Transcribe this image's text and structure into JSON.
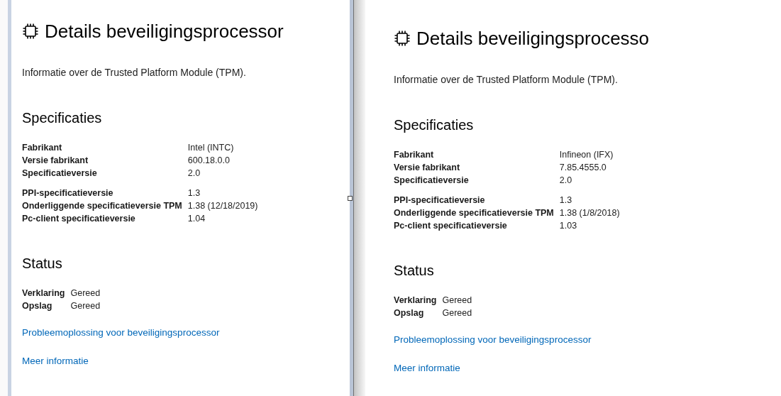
{
  "panels": [
    {
      "title": "Details beveiligingsprocessor",
      "subtitle": "Informatie over de Trusted Platform Module (TPM).",
      "specs_heading": "Specificaties",
      "spec_groups": [
        [
          {
            "label": "Fabrikant",
            "value": "Intel (INTC)"
          },
          {
            "label": "Versie fabrikant",
            "value": "600.18.0.0"
          },
          {
            "label": "Specificatieversie",
            "value": "2.0"
          }
        ],
        [
          {
            "label": "PPI-specificatieversie",
            "value": "1.3"
          },
          {
            "label": "Onderliggende specificatieversie TPM",
            "value": "1.38 (12/18/2019)"
          },
          {
            "label": "Pc-client specificatieversie",
            "value": "1.04"
          }
        ]
      ],
      "status_heading": "Status",
      "status": [
        {
          "label": "Verklaring",
          "value": "Gereed"
        },
        {
          "label": "Opslag",
          "value": "Gereed"
        }
      ],
      "links": [
        "Probleemoplossing voor beveiligingsprocessor",
        "Meer informatie"
      ]
    },
    {
      "title": "Details beveiligingsprocesso",
      "subtitle": "Informatie over de Trusted Platform Module (TPM).",
      "specs_heading": "Specificaties",
      "spec_groups": [
        [
          {
            "label": "Fabrikant",
            "value": "Infineon (IFX)"
          },
          {
            "label": "Versie fabrikant",
            "value": "7.85.4555.0"
          },
          {
            "label": "Specificatieversie",
            "value": "2.0"
          }
        ],
        [
          {
            "label": "PPI-specificatieversie",
            "value": "1.3"
          },
          {
            "label": "Onderliggende specificatieversie TPM",
            "value": "1.38 (1/8/2018)"
          },
          {
            "label": "Pc-client specificatieversie",
            "value": "1.03"
          }
        ]
      ],
      "status_heading": "Status",
      "status": [
        {
          "label": "Verklaring",
          "value": "Gereed"
        },
        {
          "label": "Opslag",
          "value": "Gereed"
        }
      ],
      "links": [
        "Probleemoplossing voor beveiligingsprocessor",
        "Meer informatie"
      ]
    }
  ]
}
